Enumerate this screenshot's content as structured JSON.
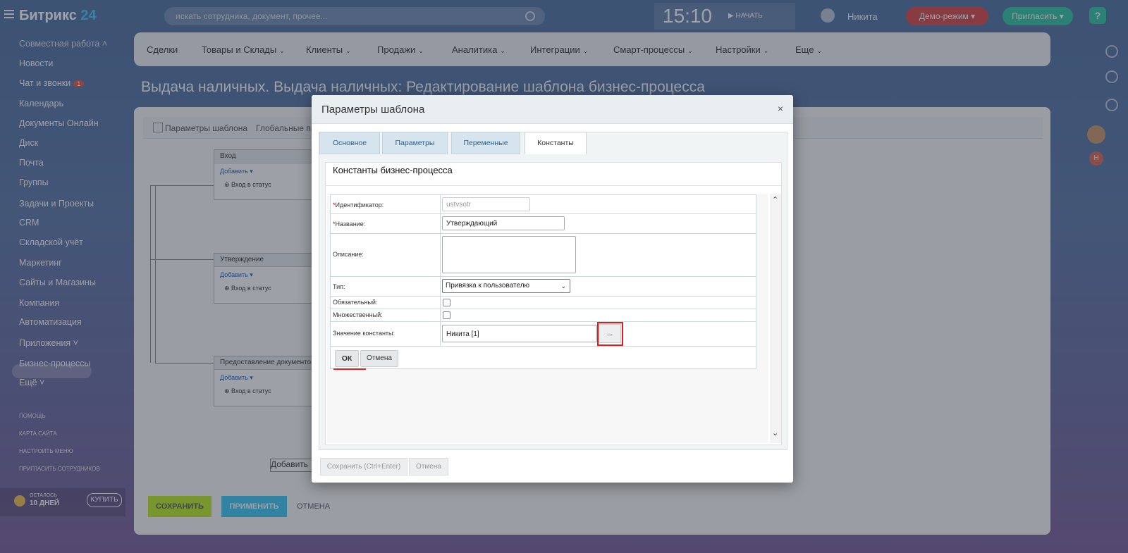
{
  "topbar": {
    "logo_main": "Битрикс",
    "logo_num": "24",
    "search_placeholder": "искать сотрудника, документ, прочее...",
    "clock": "15:10",
    "start_label": "НАЧАТЬ",
    "user_name": "Никита",
    "demo_label": "Демо-режим",
    "invite_label": "Пригласить"
  },
  "sidebar": {
    "section": "Совместная работа",
    "items": [
      "Новости",
      "Чат и звонки",
      "Календарь",
      "Документы Онлайн",
      "Диск",
      "Почта",
      "Группы",
      "Задачи и Проекты",
      "CRM",
      "Складской учёт",
      "Маркетинг",
      "Сайты и Магазины",
      "Компания",
      "Автоматизация",
      "Приложения",
      "Бизнес-процессы",
      "Ещё"
    ],
    "chat_counter": "1",
    "footer": [
      "ПОМОЩЬ",
      "КАРТА САЙТА",
      "НАСТРОИТЬ МЕНЮ",
      "ПРИГЛАСИТЬ СОТРУДНИКОВ"
    ],
    "trial_line1": "ОСТАЛОСЬ",
    "trial_line2": "10 ДНЕЙ",
    "buy_label": "КУПИТЬ"
  },
  "nav": {
    "items": [
      "Сделки",
      "Товары и Склады",
      "Клиенты",
      "Продажи",
      "Аналитика",
      "Интеграции",
      "Смарт-процессы",
      "Настройки",
      "Еще"
    ]
  },
  "page": {
    "title": "Выдача наличных. Выдача наличных: Редактирование шаблона бизнес-процесса",
    "tab1": "Параметры шаблона",
    "tab2": "Глобальные па",
    "blocks": [
      {
        "title": "Вход",
        "add": "Добавить",
        "status": "Вход в статус"
      },
      {
        "title": "Утверждение",
        "add": "Добавить",
        "status": "Вход в статус"
      },
      {
        "title": "Предоставление документов",
        "add": "Добавить",
        "status": "Вход в статус"
      }
    ],
    "add_bottom": "Добавить",
    "save": "СОХРАНИТЬ",
    "apply": "ПРИМЕНИТЬ",
    "cancel": "ОТМЕНА"
  },
  "modal": {
    "title": "Параметры шаблона",
    "close": "×",
    "tabs": [
      "Основное",
      "Параметры",
      "Переменные",
      "Константы"
    ],
    "panel_title": "Константы бизнес-процесса",
    "fields": {
      "id_label": "Идентификатор:",
      "id_value": "ustvsotr",
      "name_label": "Название:",
      "name_value": "Утверждающий",
      "desc_label": "Описание:",
      "type_label": "Тип:",
      "type_value": "Привязка к пользователю",
      "required_label": "Обязательный:",
      "multiple_label": "Множественный:",
      "value_label": "Значение константы:",
      "value_value": "Никита [1]",
      "dots": "..."
    },
    "ok": "ОК",
    "cancel": "Отмена",
    "footer_save": "Сохранить (Ctrl+Enter)",
    "footer_cancel": "Отмена"
  },
  "colors": {
    "accent_red": "#e31b1b",
    "save_green": "#bbed21",
    "apply_blue": "#3bc8f5",
    "invite_teal": "#2fc6a2",
    "demo_red": "#d94848"
  }
}
